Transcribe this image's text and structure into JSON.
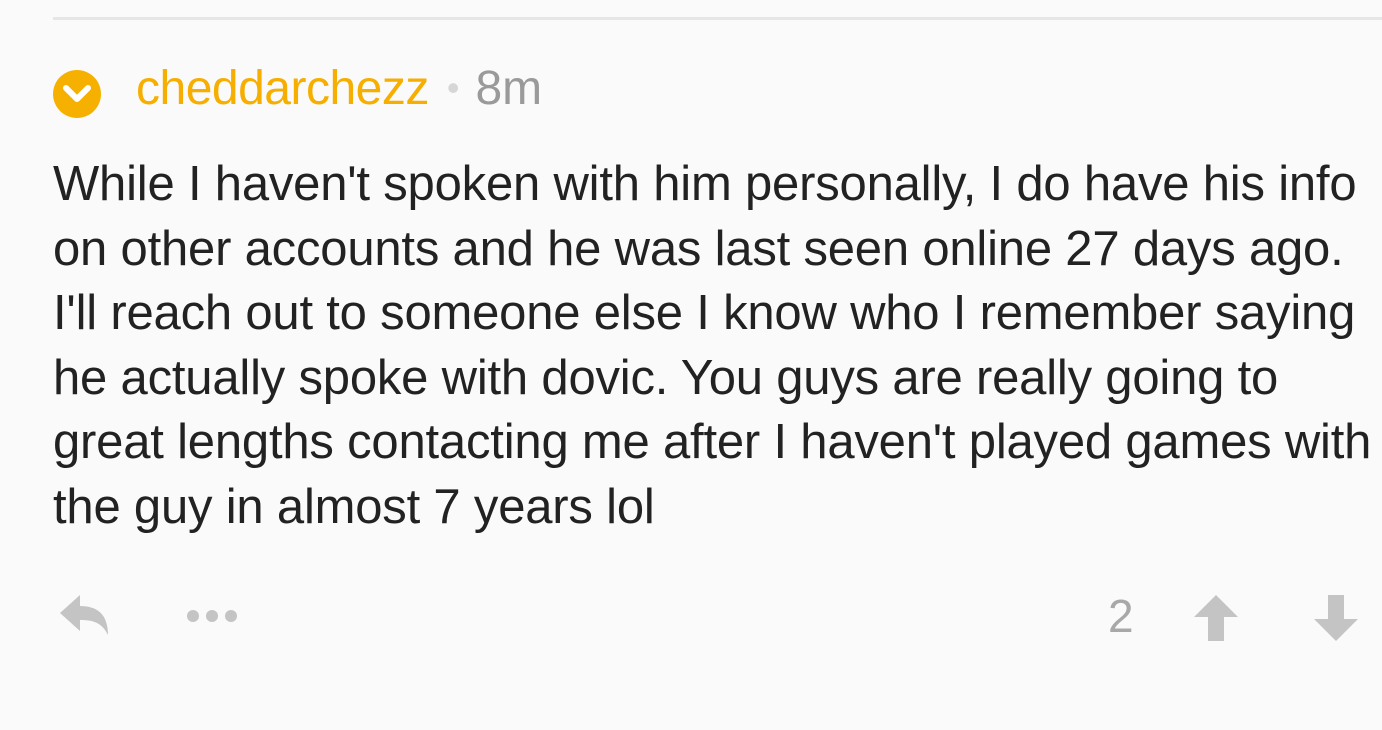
{
  "comment": {
    "username": "cheddarchezz",
    "separator": "•",
    "timestamp": "8m",
    "body": "While I haven't spoken with him personally, I do have his info on other accounts and he was last seen online 27 days ago. I'll reach out to someone else I know who I remember saying he actually spoke with dovic. You guys are really going to great lengths contacting me after I haven't played games with the guy in almost 7 years lol",
    "score": "2"
  },
  "icons": {
    "badge": "moderator-chevron-icon",
    "reply": "reply-arrow-icon",
    "more": "more-dots-icon",
    "upvote": "upvote-arrow-icon",
    "downvote": "downvote-arrow-icon"
  },
  "colors": {
    "accent": "#f6ae00",
    "text": "#222222",
    "muted": "#a8a8a8",
    "background": "#fafafa"
  }
}
